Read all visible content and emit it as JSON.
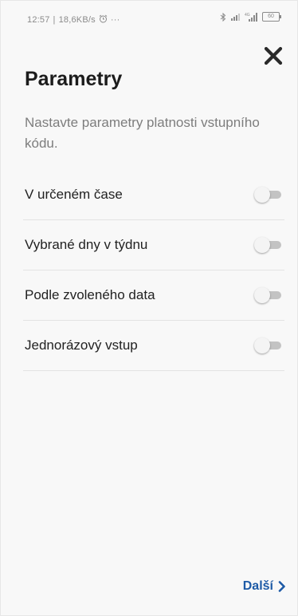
{
  "status_bar": {
    "time": "12:57",
    "speed": "18,6KB/s",
    "alarm_icon": "alarm-clock-icon",
    "more": "···",
    "signal_label": "4G",
    "battery_level": "60"
  },
  "header": {
    "title": "Parametry",
    "close_icon": "close-icon"
  },
  "description": "Nastavte parametry platnosti vstupního kódu.",
  "options": [
    {
      "label": "V určeném čase",
      "enabled": false
    },
    {
      "label": "Vybrané dny v týdnu",
      "enabled": false
    },
    {
      "label": "Podle zvoleného data",
      "enabled": false
    },
    {
      "label": "Jednorázový vstup",
      "enabled": false
    }
  ],
  "footer": {
    "next_label": "Další",
    "next_icon": "chevron-right-icon"
  },
  "colors": {
    "accent": "#1d5aa6",
    "title": "#1c1c1c",
    "subtitle": "#7d7d7d",
    "toggle_off_track": "#c3c3c3"
  }
}
